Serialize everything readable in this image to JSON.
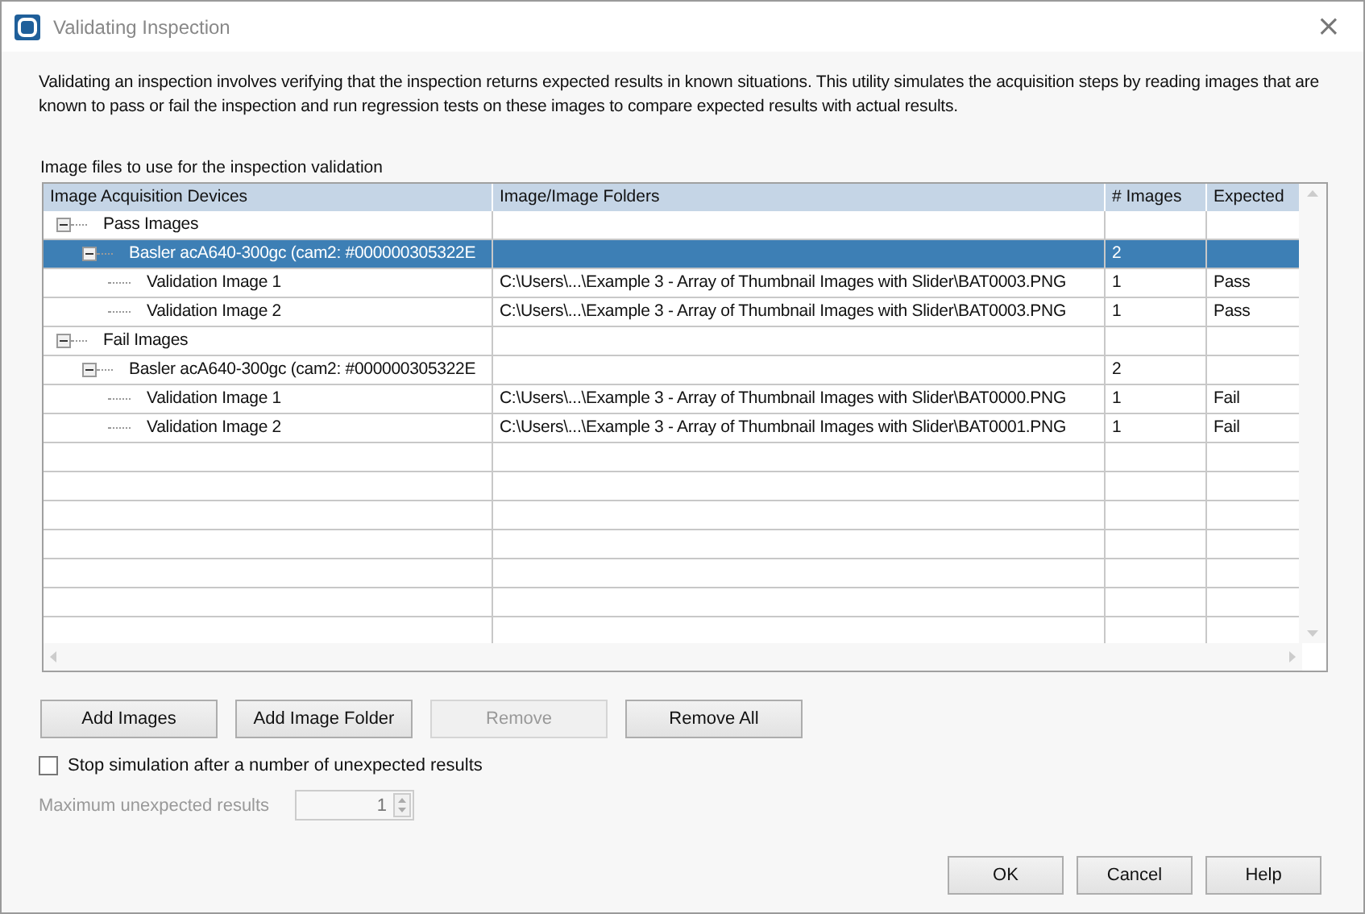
{
  "window": {
    "title": "Validating Inspection",
    "close": "×"
  },
  "description": "Validating an inspection involves verifying that the inspection returns expected results in known situations. This utility simulates the acquisition steps by reading images that are known to pass or fail the inspection and run regression tests on these images to compare expected results with actual results.",
  "table": {
    "caption": "Image files to use for the inspection validation",
    "columns": [
      "Image Acquisition Devices",
      "Image/Image Folders",
      "# Images",
      "Expected"
    ],
    "rows": [
      {
        "label": "Pass Images",
        "expanded": true,
        "selected": false,
        "children": [
          {
            "label": "Basler acA640-300gc (cam2: #000000305322E",
            "expanded": true,
            "selected": true,
            "images": "2",
            "children": [
              {
                "label": "Validation Image 1",
                "selected": false,
                "path": "C:\\Users\\...\\Example 3 - Array of Thumbnail Images with Slider\\BAT0003.PNG",
                "images": "1",
                "expected": "Pass"
              },
              {
                "label": "Validation Image 2",
                "selected": false,
                "path": "C:\\Users\\...\\Example 3 - Array of Thumbnail Images with Slider\\BAT0003.PNG",
                "images": "1",
                "expected": "Pass"
              }
            ]
          }
        ]
      },
      {
        "label": "Fail Images",
        "expanded": true,
        "selected": false,
        "children": [
          {
            "label": "Basler acA640-300gc (cam2: #000000305322E",
            "expanded": true,
            "selected": false,
            "images": "2",
            "children": [
              {
                "label": "Validation Image 1",
                "selected": false,
                "path": "C:\\Users\\...\\Example 3 - Array of Thumbnail Images with Slider\\BAT0000.PNG",
                "images": "1",
                "expected": "Fail"
              },
              {
                "label": "Validation Image 2",
                "selected": false,
                "path": "C:\\Users\\...\\Example 3 - Array of Thumbnail Images with Slider\\BAT0001.PNG",
                "images": "1",
                "expected": "Fail"
              }
            ]
          }
        ]
      }
    ]
  },
  "buttons": [
    {
      "label": "Add Images",
      "disabled": false
    },
    {
      "label": "Add Image Folder",
      "disabled": false
    },
    {
      "label": "Remove",
      "disabled": true
    },
    {
      "label": "Remove All",
      "disabled": false
    }
  ],
  "stop_option": {
    "label": "Stop simulation after a number of unexpected results",
    "checked": false
  },
  "max_unexpected": {
    "label": "Maximum unexpected results",
    "value": "1",
    "disabled": true
  },
  "dialog_buttons": [
    "OK",
    "Cancel",
    "Help"
  ]
}
